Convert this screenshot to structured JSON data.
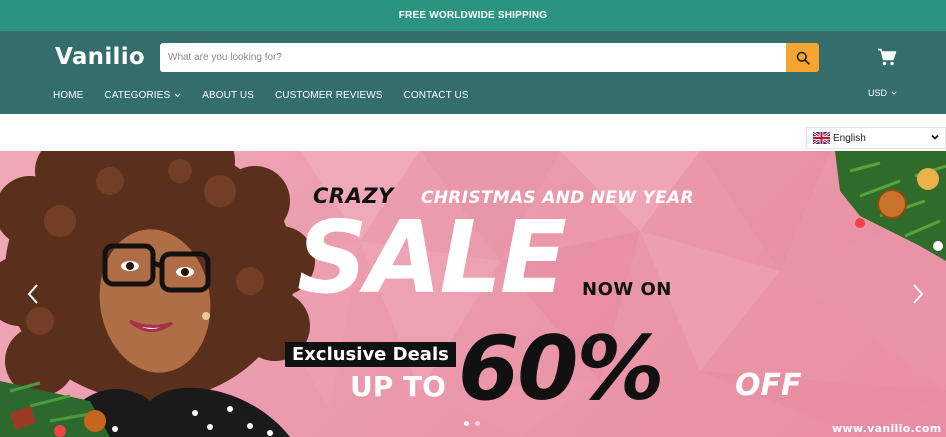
{
  "announcement": "FREE WORLDWIDE SHIPPING",
  "brand": "Vanilio",
  "search": {
    "placeholder": "What are you looking for?"
  },
  "icons": {
    "search": "search-icon",
    "cart": "cart-icon",
    "chevron": "chevron-down-icon",
    "prev": "chevron-left-icon",
    "next": "chevron-right-icon",
    "flag": "uk-flag-icon"
  },
  "nav": [
    {
      "label": "HOME"
    },
    {
      "label": "CATEGORIES",
      "has_dropdown": true
    },
    {
      "label": "ABOUT US"
    },
    {
      "label": "CUSTOMER REVIEWS"
    },
    {
      "label": "CONTACT US"
    }
  ],
  "currency": "USD",
  "language": "English",
  "hero": {
    "crazy": "CRAZY",
    "headline": "CHRISTMAS AND NEW YEAR",
    "sale": "SALE",
    "now_on": "NOW ON",
    "exclusive": "Exclusive Deals",
    "up_to": "UP TO",
    "percent": "60%",
    "off": "OFF",
    "url": "www.vanilio.com",
    "slides": 2,
    "active_slide": 1
  },
  "colors": {
    "announce_bar": "#2b9481",
    "header": "#336d6c",
    "search_button": "#f6a630",
    "hero_bg": "#ee9fb1"
  }
}
